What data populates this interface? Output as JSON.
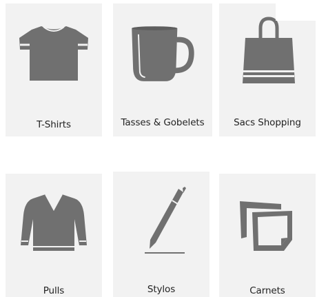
{
  "icon_color": "#707070",
  "card_background": "#f2f2f2",
  "categories": [
    {
      "label": "T-Shirts",
      "icon": "tshirt-icon"
    },
    {
      "label": "Tasses & Gobelets",
      "icon": "mug-icon"
    },
    {
      "label": "Sacs Shopping",
      "icon": "shopping-bag-icon"
    },
    {
      "label": "Pulls",
      "icon": "sweater-icon"
    },
    {
      "label": "Stylos",
      "icon": "pen-icon"
    },
    {
      "label": "Carnets",
      "icon": "notepad-icon"
    }
  ]
}
